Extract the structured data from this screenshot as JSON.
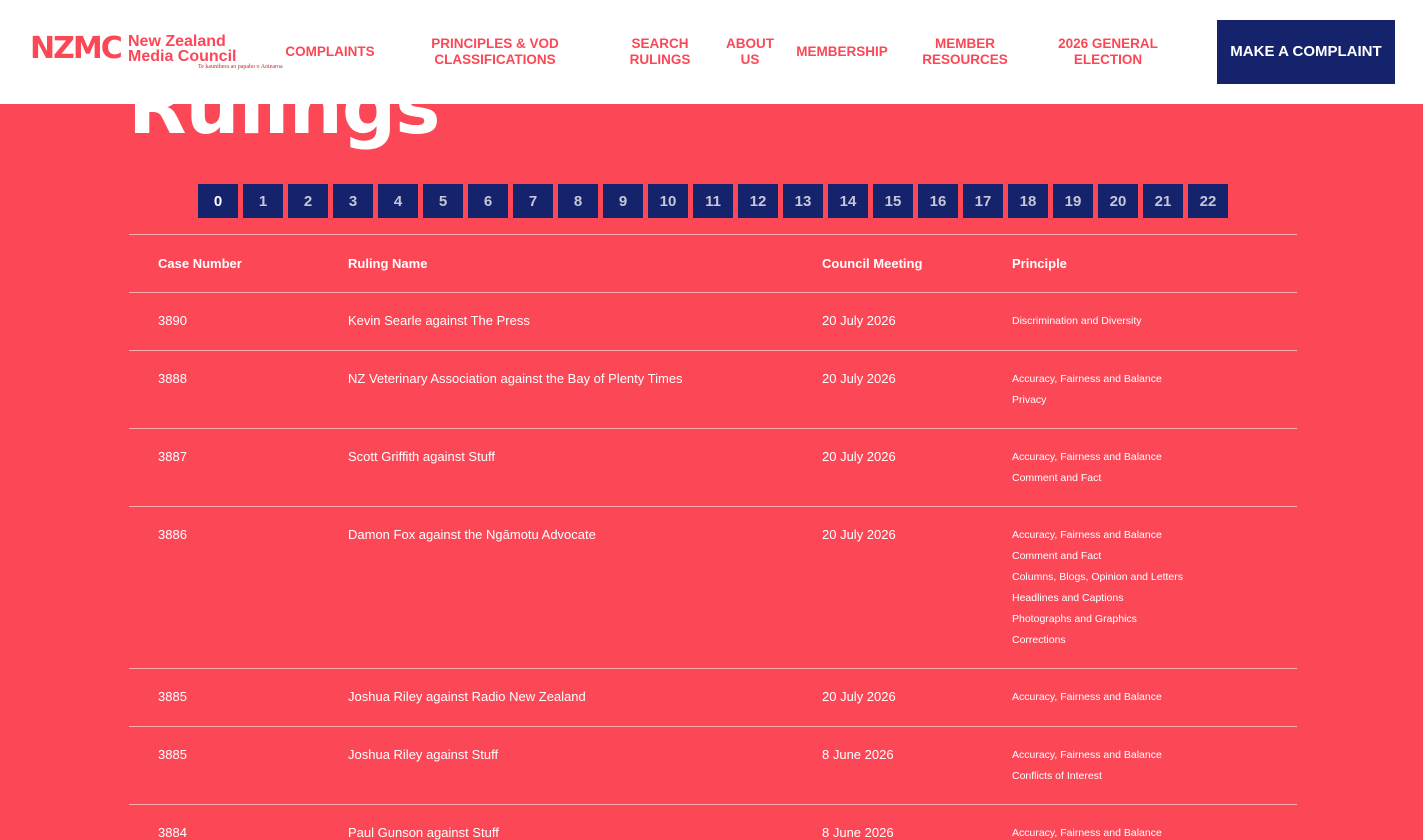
{
  "header": {
    "logo": {
      "mark": "NZMC",
      "name_line1": "New Zealand",
      "name_line2": "Media Council",
      "tagline": "Te kaunihera ao papaho o Aotearoa"
    },
    "nav": [
      {
        "label": "COMPLAINTS"
      },
      {
        "label": "PRINCIPLES & VOD CLASSIFICATIONS"
      },
      {
        "label": "SEARCH RULINGS"
      },
      {
        "label": "ABOUT US"
      },
      {
        "label": "MEMBERSHIP"
      },
      {
        "label": "MEMBER RESOURCES"
      },
      {
        "label": "2026 GENERAL ELECTION"
      }
    ],
    "cta_label": "MAKE A COMPLAINT"
  },
  "page_title": "Rulings",
  "pagination": {
    "pages": [
      "0",
      "1",
      "2",
      "3",
      "4",
      "5",
      "6",
      "7",
      "8",
      "9",
      "10",
      "11",
      "12",
      "13",
      "14",
      "15",
      "16",
      "17",
      "18",
      "19",
      "20",
      "21",
      "22"
    ],
    "current": "0"
  },
  "table": {
    "columns": [
      "Case Number",
      "Ruling Name",
      "Council Meeting",
      "Principle"
    ],
    "rows": [
      {
        "case": "3890",
        "name": "Kevin Searle against The Press",
        "meeting": "20 July 2026",
        "principles": [
          "Discrimination and Diversity"
        ]
      },
      {
        "case": "3888",
        "name": "NZ Veterinary Association against the Bay of Plenty Times",
        "meeting": "20 July 2026",
        "principles": [
          "Accuracy, Fairness and Balance",
          "Privacy"
        ]
      },
      {
        "case": "3887",
        "name": "Scott Griffith against Stuff",
        "meeting": "20 July 2026",
        "principles": [
          "Accuracy, Fairness and Balance",
          "Comment and Fact"
        ]
      },
      {
        "case": "3886",
        "name": "Damon Fox against the Ngāmotu Advocate",
        "meeting": "20 July 2026",
        "principles": [
          "Accuracy, Fairness and Balance",
          "Comment and Fact",
          "Columns, Blogs, Opinion and Letters",
          "Headlines and Captions",
          "Photographs and Graphics",
          "Corrections"
        ]
      },
      {
        "case": "3885",
        "name": "Joshua Riley against Radio New Zealand",
        "meeting": "20 July 2026",
        "principles": [
          "Accuracy, Fairness and Balance"
        ]
      },
      {
        "case": "3885",
        "name": "Joshua Riley against Stuff",
        "meeting": "8 June 2026",
        "principles": [
          "Accuracy, Fairness and Balance",
          "Conflicts of Interest"
        ]
      },
      {
        "case": "3884",
        "name": "Paul Gunson against Stuff",
        "meeting": "8 June 2026",
        "principles": [
          "Accuracy, Fairness and Balance"
        ]
      }
    ]
  },
  "colors": {
    "background": "#fb4756",
    "navy": "#15236d",
    "white": "#ffffff"
  }
}
